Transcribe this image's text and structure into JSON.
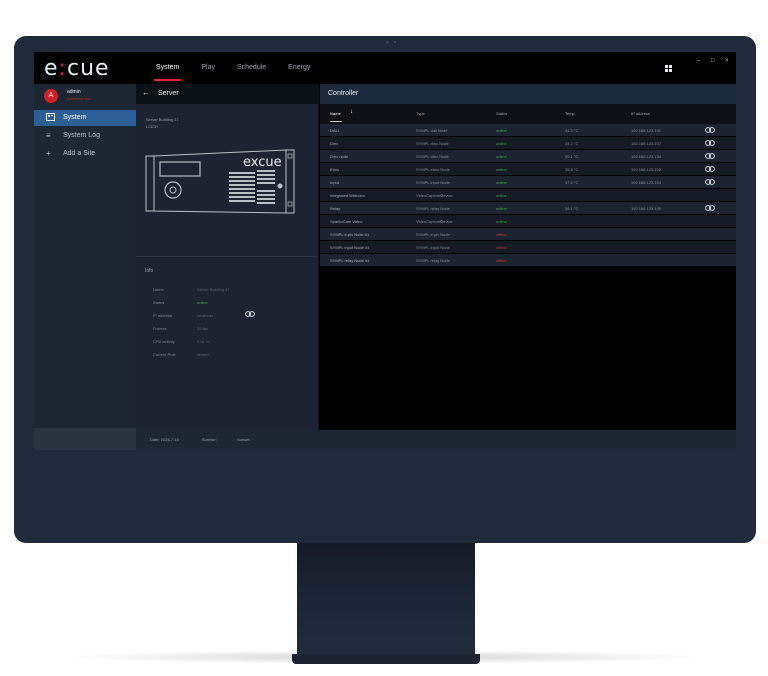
{
  "app": {
    "logo_left": "e",
    "logo_mark": ":",
    "logo_right": "cue"
  },
  "nav": [
    "System",
    "Play",
    "Schedule",
    "Energy"
  ],
  "window_controls": {
    "minimize": "–",
    "maximize": "□",
    "close": "×"
  },
  "user": {
    "initial": "A",
    "name": "admin",
    "role": "Administrator"
  },
  "sidebar": [
    {
      "label": "System",
      "icon": "screen-icon"
    },
    {
      "label": "System Log",
      "icon": "≡"
    },
    {
      "label": "Add a Site",
      "icon": "+"
    }
  ],
  "server": {
    "back_icon": "←",
    "title": "Server",
    "name": "Server Building 17",
    "model": "LCE3+",
    "device_logo": "excue"
  },
  "info": {
    "title": "Info",
    "rows": [
      {
        "key": "Name",
        "value": "Server Building 17"
      },
      {
        "key": "Status",
        "value": "online"
      },
      {
        "key": "IP address",
        "value": "localhost"
      },
      {
        "key": "Frames",
        "value": "30 fps"
      },
      {
        "key": "CPU activity",
        "value": "2.91 %"
      },
      {
        "key": "Current Role",
        "value": "Master"
      }
    ]
  },
  "controller": {
    "title": "Controller",
    "sort_icon": "↓",
    "columns": [
      "Name",
      "Type",
      "Status",
      "Temp.",
      "IP address"
    ],
    "rows": [
      {
        "name": "DALI",
        "type": "SYMPL dali Node",
        "status": "online",
        "temp": "41.3 °C",
        "ip": "192.168.123.101",
        "link": true
      },
      {
        "name": "Dmx",
        "type": "SYMPL dmx Node",
        "status": "online",
        "temp": "34.2 °C",
        "ip": "192.168.123.107",
        "link": true
      },
      {
        "name": "Dmx node",
        "type": "SYMPL dmx Node",
        "status": "online",
        "temp": "50.1 °C",
        "ip": "192.168.123.134",
        "link": true
      },
      {
        "name": "Ebus",
        "type": "SYMPL ebus Node",
        "status": "online",
        "temp": "35.8 °C",
        "ip": "192.168.123.102",
        "link": true
      },
      {
        "name": "Input",
        "type": "SYMPL input Node",
        "status": "online",
        "temp": "37.4 °C",
        "ip": "192.168.123.104",
        "link": true
      },
      {
        "name": "Integrated Webcam",
        "type": "VideoCaptureDevice",
        "status": "online",
        "temp": "",
        "ip": "",
        "link": false
      },
      {
        "name": "Relay",
        "type": "SYMPL relay Node",
        "status": "online",
        "temp": "36.1 °C",
        "ip": "192.168.123.105",
        "link": true
      },
      {
        "name": "SparkoCam Video",
        "type": "VideoCaptureDevice",
        "status": "online",
        "temp": "",
        "ip": "",
        "link": false
      },
      {
        "name": "SYMPL e:pix Node #1",
        "type": "SYMPL e:pix Node",
        "status": "offline",
        "temp": "",
        "ip": "",
        "link": false
      },
      {
        "name": "SYMPL input Node #1",
        "type": "SYMPL input Node",
        "status": "offline",
        "temp": "",
        "ip": "",
        "link": false
      },
      {
        "name": "SYMPL relay Node #1",
        "type": "SYMPL relay Node",
        "status": "offline",
        "temp": "",
        "ip": "",
        "link": false
      }
    ]
  },
  "statusbar": {
    "date": "Date: 2024-7-15",
    "sunrise": "Sunrise:",
    "sunset": "Sunset:"
  },
  "colors": {
    "accent": "#e2232a",
    "selection": "#2b5f96",
    "online": "#3db34a",
    "offline": "#d2352f"
  }
}
